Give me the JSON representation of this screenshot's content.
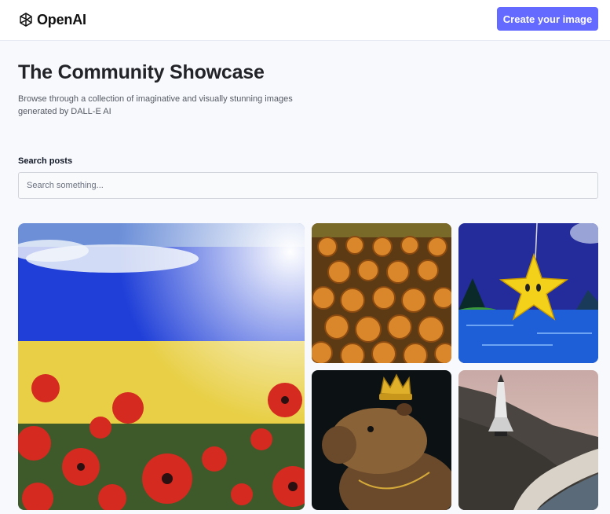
{
  "header": {
    "brand": "OpenAI",
    "logo_icon": "openai-logo-icon",
    "create_button_label": "Create your image",
    "accent_color": "#6469ff"
  },
  "hero": {
    "title": "The Community Showcase",
    "subtitle": "Browse through a collection of imaginative and visually stunning images generated by DALL-E AI"
  },
  "search": {
    "label": "Search posts",
    "placeholder": "Search something...",
    "value": ""
  },
  "gallery": {
    "images": [
      {
        "subject": "Ukrainian flag sky over poppy field"
      },
      {
        "subject": "Sunflower field painting"
      },
      {
        "subject": "Cartoon star in water"
      },
      {
        "subject": "Capybara wearing a crown"
      },
      {
        "subject": "Space shuttle above coastline"
      }
    ]
  }
}
